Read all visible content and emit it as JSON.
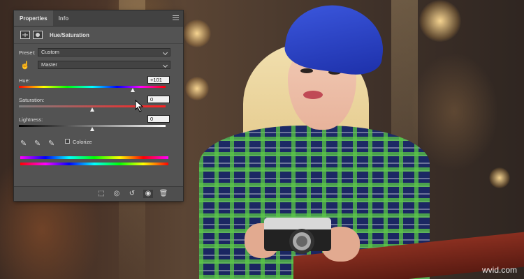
{
  "panel": {
    "tabs": [
      {
        "label": "Properties"
      },
      {
        "label": "Info"
      }
    ],
    "header_title": "Hue/Saturation",
    "preset_label": "Preset:",
    "preset_value": "Custom",
    "channel_value": "Master",
    "hue_label": "Hue:",
    "hue_value": "+101",
    "hue_level": 101,
    "saturation_label": "Saturation:",
    "saturation_value": "0",
    "saturation_level": 0,
    "lightness_label": "Lightness:",
    "lightness_value": "0",
    "lightness_level": 0,
    "colorize_label": "Colorize",
    "colorize_checked": false,
    "footer_icons": [
      "clip-to-layer-icon",
      "view-previous-icon",
      "reset-icon",
      "visibility-eye-icon",
      "trash-icon"
    ]
  },
  "watermark": "wvid.com",
  "colors": {
    "panel_bg": "#535353",
    "panel_tab_bar": "#424242",
    "field_bg": "#f0f0f0"
  }
}
